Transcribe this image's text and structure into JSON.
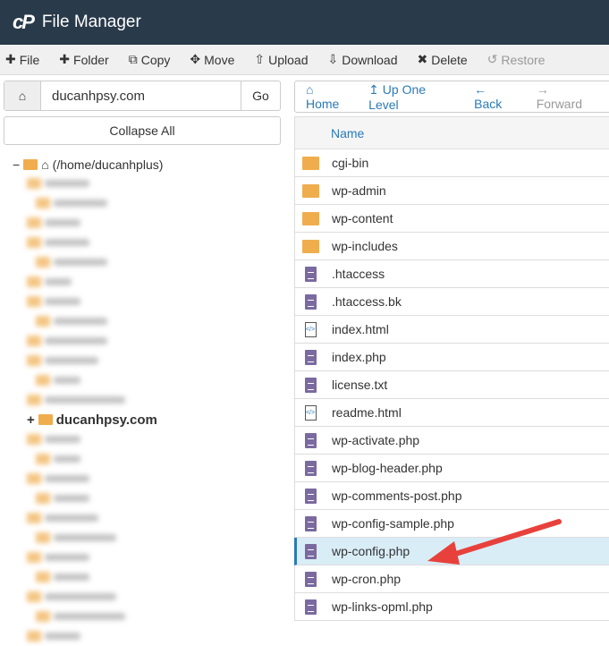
{
  "header": {
    "logo": "cP",
    "title": "File Manager"
  },
  "toolbar": [
    {
      "icon": "plus",
      "label": "File"
    },
    {
      "icon": "plus",
      "label": "Folder"
    },
    {
      "icon": "copy",
      "label": "Copy"
    },
    {
      "icon": "move",
      "label": "Move"
    },
    {
      "icon": "upload",
      "label": "Upload"
    },
    {
      "icon": "download",
      "label": "Download"
    },
    {
      "icon": "close",
      "label": "Delete"
    },
    {
      "icon": "restore",
      "label": "Restore",
      "disabled": true
    }
  ],
  "path": {
    "value": "ducanhpsy.com",
    "go": "Go"
  },
  "collapse": "Collapse All",
  "tree": {
    "root": "(/home/ducanhplus)",
    "current": "ducanhpsy.com"
  },
  "nav": {
    "home": "Home",
    "up": "Up One Level",
    "back": "Back",
    "forward": "Forward"
  },
  "list": {
    "header": "Name",
    "files": [
      {
        "name": "cgi-bin",
        "type": "folder"
      },
      {
        "name": "wp-admin",
        "type": "folder"
      },
      {
        "name": "wp-content",
        "type": "folder"
      },
      {
        "name": "wp-includes",
        "type": "folder"
      },
      {
        "name": ".htaccess",
        "type": "text"
      },
      {
        "name": ".htaccess.bk",
        "type": "text"
      },
      {
        "name": "index.html",
        "type": "html"
      },
      {
        "name": "index.php",
        "type": "text"
      },
      {
        "name": "license.txt",
        "type": "text"
      },
      {
        "name": "readme.html",
        "type": "html"
      },
      {
        "name": "wp-activate.php",
        "type": "text"
      },
      {
        "name": "wp-blog-header.php",
        "type": "text"
      },
      {
        "name": "wp-comments-post.php",
        "type": "text"
      },
      {
        "name": "wp-config-sample.php",
        "type": "text"
      },
      {
        "name": "wp-config.php",
        "type": "text",
        "selected": true
      },
      {
        "name": "wp-cron.php",
        "type": "text"
      },
      {
        "name": "wp-links-opml.php",
        "type": "text"
      }
    ]
  },
  "colors": {
    "header": "#293a4a",
    "link": "#2a7ab8",
    "folder": "#f0ad4e",
    "arrow": "#e8413c",
    "selected": "#d9edf7"
  }
}
